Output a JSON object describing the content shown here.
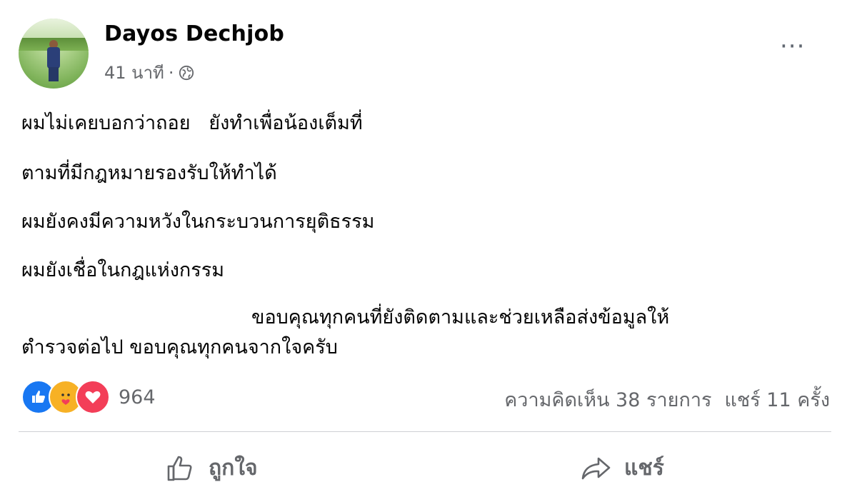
{
  "post": {
    "author": "Dayos Dechjob",
    "time": "41 นาที",
    "separator": "·",
    "more_label": "···",
    "lines": [
      "ผมไม่เคยบอกว่าถอย   ยังทำเพื่อน้องเต็มที่",
      "ตามที่มีกฎหมายรองรับให้ทำได้",
      "ผมยังคงมีความหวังในกระบวนการยุติธรรม",
      "ผมยังเชื่อในกฎแห่งกรรม",
      "ขอบคุณทุกคนที่ยังติดตามและช่วยเหลือส่งข้อมูลให้",
      "ตำรวจต่อไป ขอบคุณทุกคนจากใจครับ"
    ]
  },
  "engagement": {
    "reaction_count": "964",
    "comments": "ความคิดเห็น 38 รายการ",
    "shares": "แชร์ 11 ครั้ง",
    "reaction_icons": [
      "like-icon",
      "care-icon",
      "love-icon"
    ]
  },
  "actions": {
    "like_label": "ถูกใจ",
    "share_label": "แชร์"
  },
  "colors": {
    "like_blue": "#1877f2",
    "care_yellow": "#f7b125",
    "love_red": "#f33e58",
    "secondary_text": "#65676b"
  }
}
